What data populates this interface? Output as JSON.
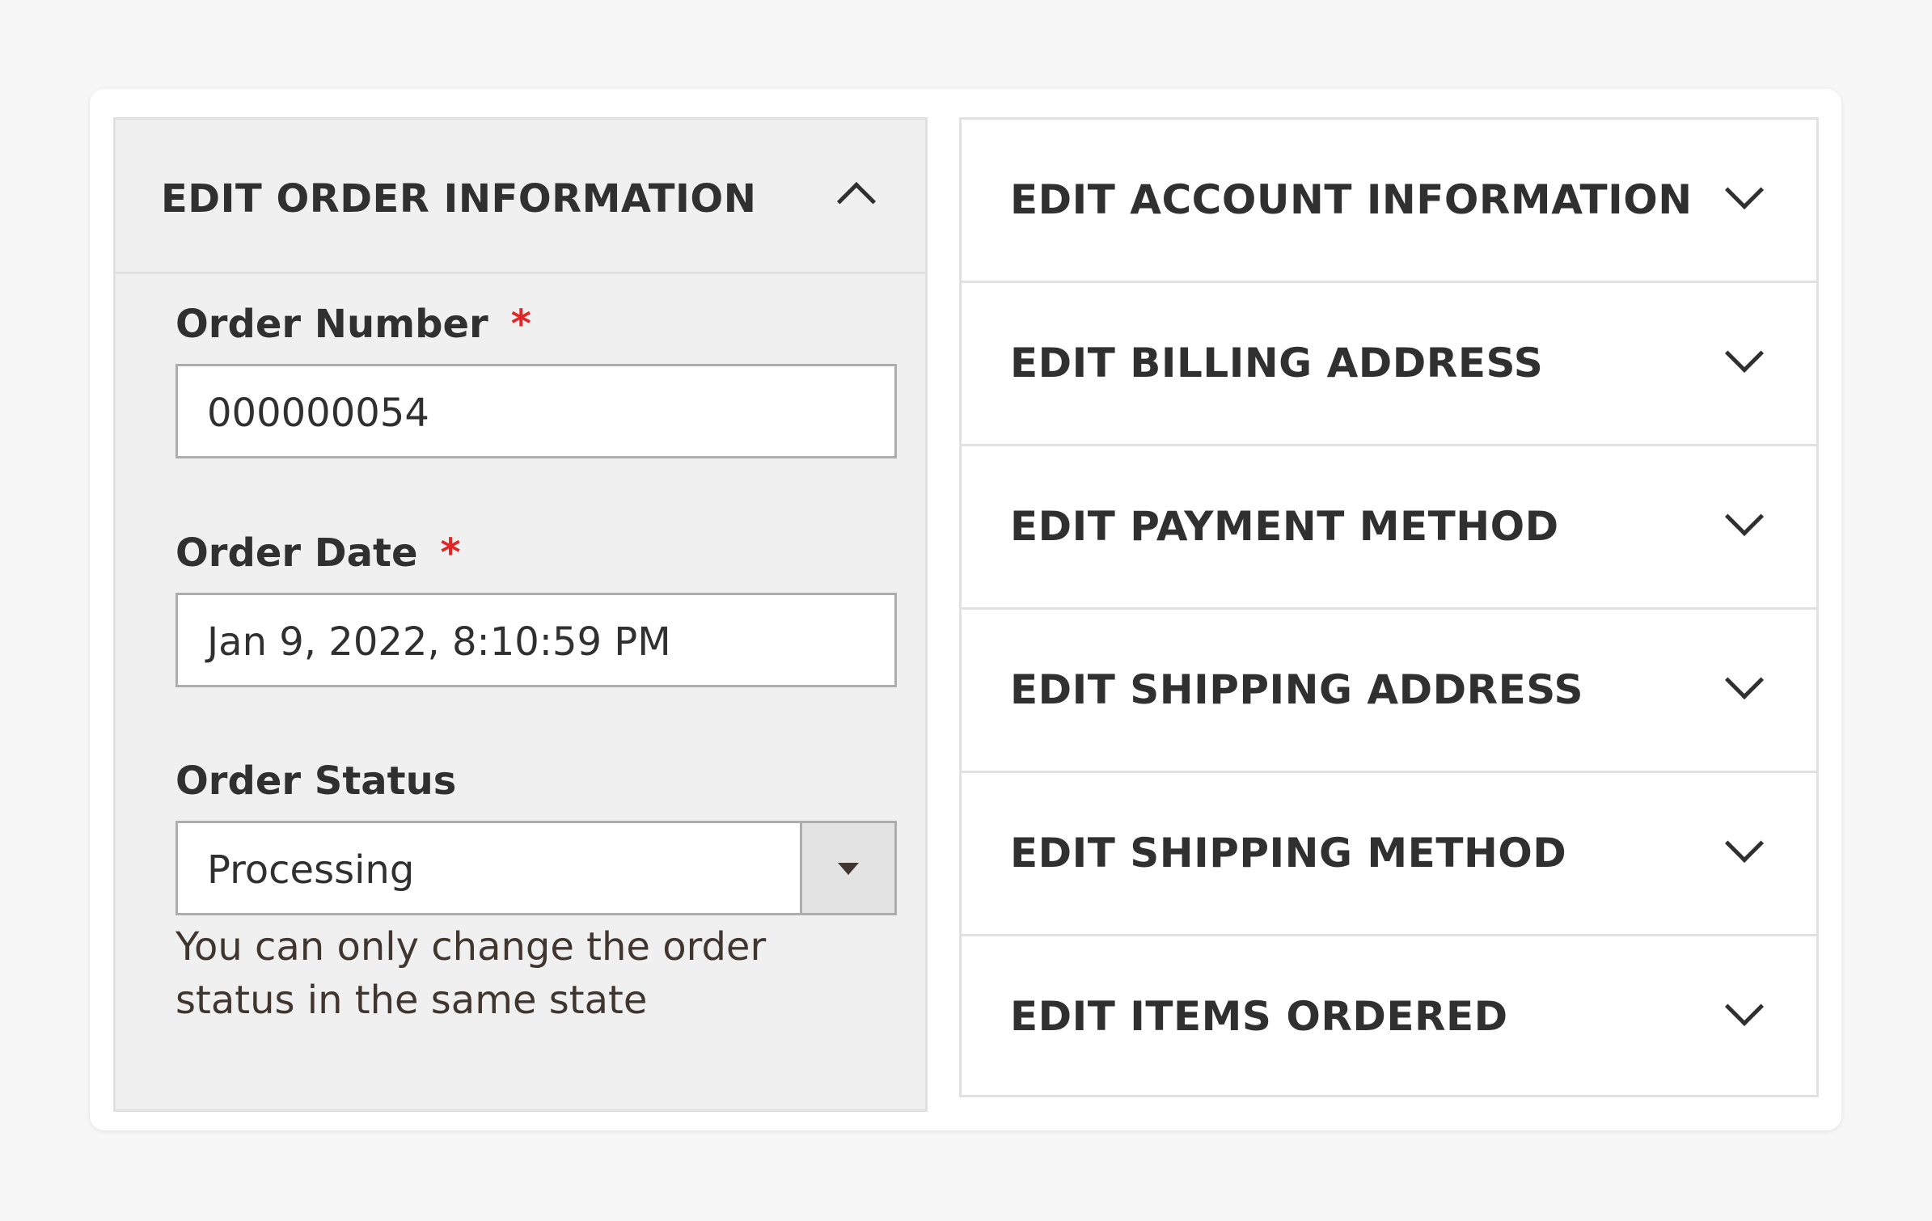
{
  "left_panel": {
    "title": "EDIT ORDER INFORMATION",
    "toggle_icon": "chevron-up-icon",
    "order_number": {
      "label": "Order Number",
      "required_mark": "*",
      "value": "000000054"
    },
    "order_date": {
      "label": "Order Date",
      "required_mark": "*",
      "value": "Jan 9, 2022, 8:10:59 PM"
    },
    "order_status": {
      "label": "Order Status",
      "selected": "Processing",
      "dropdown_icon": "caret-down-icon",
      "note": "You can only change the order status in the same state"
    }
  },
  "accordion": [
    {
      "title": "EDIT ACCOUNT INFORMATION",
      "icon": "chevron-down-icon"
    },
    {
      "title": "EDIT BILLING ADDRESS",
      "icon": "chevron-down-icon"
    },
    {
      "title": "EDIT PAYMENT METHOD",
      "icon": "chevron-down-icon"
    },
    {
      "title": "EDIT SHIPPING ADDRESS",
      "icon": "chevron-down-icon"
    },
    {
      "title": "EDIT SHIPPING METHOD",
      "icon": "chevron-down-icon"
    },
    {
      "title": "EDIT ITEMS ORDERED",
      "icon": "chevron-down-icon"
    }
  ],
  "colors": {
    "required": "#e22626",
    "panel_bg": "#f0f0f0",
    "text": "#303030"
  }
}
